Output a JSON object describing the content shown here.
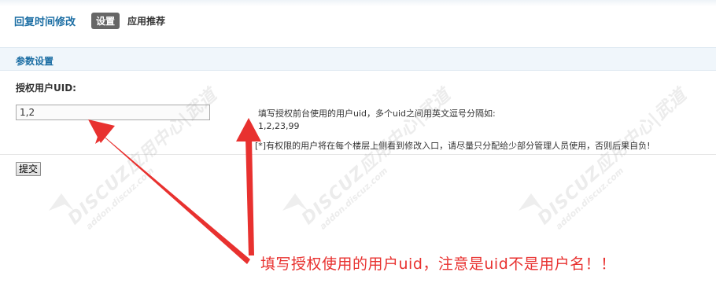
{
  "nav": {
    "title": "回复时间修改",
    "active_tab": "设置",
    "tab2": "应用推荐"
  },
  "section": {
    "title": "参数设置"
  },
  "field": {
    "label": "授权用户UID:",
    "value": "1,2"
  },
  "hints": {
    "line1": "填写授权前台使用的用户uid，多个uid之间用英文逗号分隔如:",
    "line2": "1,2,23,99",
    "line3": "[*]有权限的用户将在每个楼层上侧看到修改入口，请尽量只分配给少部分管理人员使用，否则后果自负!"
  },
  "submit_label": "提交",
  "annotation": "填写授权使用的用户uid，注意是uid不是用户名！！",
  "watermarks": [
    {
      "brand": "DISCUZ",
      "tail": "应用中心|武道",
      "domain": "addon.discuz.com"
    },
    {
      "brand": "DISCUZ",
      "tail": "应用中心|武道",
      "domain": "addon.discuz.com"
    },
    {
      "brand": "DISCUZ",
      "tail": "应用中心|武道",
      "domain": "addon.discuz.com"
    }
  ],
  "colors": {
    "accent": "#1c6ea4",
    "annotation_red": "#e8312f",
    "section_bg": "#f0f6fb"
  }
}
